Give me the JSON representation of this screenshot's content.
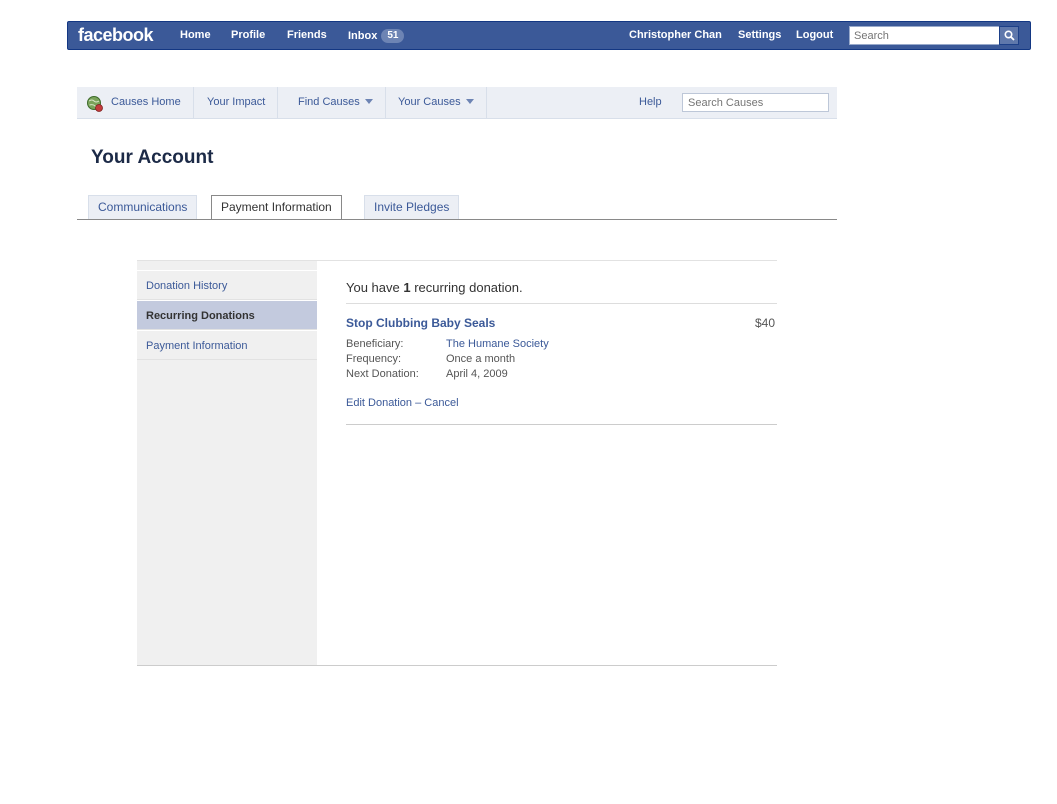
{
  "topbar": {
    "logo": "facebook",
    "nav": {
      "home": "Home",
      "profile": "Profile",
      "friends": "Friends",
      "inbox": "Inbox",
      "inbox_count": "51"
    },
    "user_name": "Christopher Chan",
    "settings": "Settings",
    "logout": "Logout",
    "search_placeholder": "Search"
  },
  "causes_nav": {
    "home": "Causes Home",
    "impact": "Your Impact",
    "find": "Find Causes",
    "yours": "Your Causes",
    "help": "Help",
    "search_placeholder": "Search Causes"
  },
  "page": {
    "title": "Your Account"
  },
  "tabs": [
    {
      "label": "Communications",
      "active": false
    },
    {
      "label": "Payment Information",
      "active": true
    },
    {
      "label": "Invite Pledges",
      "active": false
    }
  ],
  "sidebar": {
    "items": [
      {
        "label": "Donation History",
        "active": false
      },
      {
        "label": "Recurring Donations",
        "active": true
      },
      {
        "label": "Payment Information",
        "active": false
      }
    ]
  },
  "main": {
    "summary_prefix": "You have ",
    "summary_count": "1",
    "summary_suffix": " recurring donation.",
    "donation": {
      "cause": "Stop Clubbing Baby Seals",
      "amount": "$40",
      "beneficiary_label": "Beneficiary:",
      "beneficiary": "The Humane Society",
      "frequency_label": "Frequency:",
      "frequency": "Once a month",
      "next_label": "Next Donation:",
      "next_date": "April 4, 2009",
      "edit": "Edit Donation",
      "separator": " – ",
      "cancel": "Cancel"
    }
  },
  "colors": {
    "brand": "#3b5998",
    "bar_border": "#133783",
    "active_side": "#c3cade"
  },
  "icons": {
    "search": "magnifier-icon",
    "causes": "globe-icon",
    "dropdown": "caret-down-icon"
  }
}
